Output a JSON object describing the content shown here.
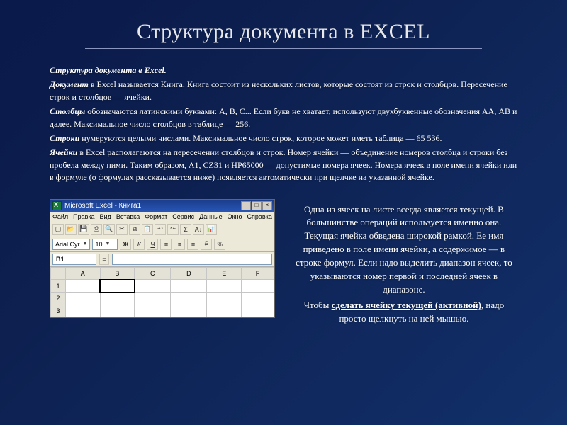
{
  "title": "Структура документа в EXCEL",
  "p1_bold": "Структура документа в Excel.",
  "p2_a": "Документ",
  "p2_b": " в Excel называется Книга. Книга состоит из нескольких листов, которые состоят из строк и столбцов. Пересечение строк и столбцов — ячейки.",
  "p3_a": "Столбцы",
  "p3_b": " обозначаются латинскими буквами: А, В, С... Если букв не хватает, используют двухбуквенные обозначения АА, АВ и далее. Максимальное число столбцов в таблице — 256.",
  "p4_a": "Строки",
  "p4_b": " нумеруются целыми числами. Максимальное число строк, которое может иметь таблица — 65 536.",
  "p5_a": "Ячейки",
  "p5_b": " в Excel располагаются на пересечении столбцов и строк. Номер ячейки — объединение номеров столбца и строки без пробела между ними. Таким образом, А1, CZ31 и НР65000 — допустимые номера ячеек. Номера ячеек в поле имени ячейки или в формуле (о формулах рассказывается ниже) появляется автоматически при щелчке на указанной ячейке.",
  "side1": "Одна из ячеек на листе всегда является текущей. В большинстве операций используется именно она. Текущая ячейка обведена широкой рамкой. Ее имя приведено в поле имени ячейки, а содержимое — в строке формул. Если надо выделить диапазон ячеек, то указываются номер первой и последней ячеек в диапазоне.",
  "side2_a": "Чтобы ",
  "side2_u": "сделать ячейку текущей (активной)",
  "side2_b": ", надо просто щелкнуть на ней мышью.",
  "excel": {
    "title": "Microsoft Excel - Книга1",
    "menus": [
      "Файл",
      "Правка",
      "Вид",
      "Вставка",
      "Формат",
      "Сервис",
      "Данные",
      "Окно",
      "Справка"
    ],
    "font": "Arial Cyr",
    "size": "10",
    "namebox": "B1",
    "cols": [
      "A",
      "B",
      "C",
      "D",
      "E",
      "F"
    ],
    "rows": [
      "1",
      "2",
      "3"
    ]
  }
}
